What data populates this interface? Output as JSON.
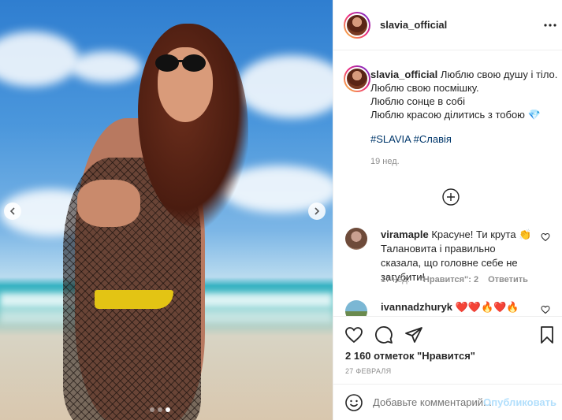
{
  "post": {
    "username": "slavia_official",
    "caption": {
      "username": "slavia_official",
      "lines": [
        "Люблю свою душу і тіло.",
        "Люблю свою посмішку.",
        "Люблю сонце в собі",
        "Люблю красою ділитись з тобою"
      ],
      "hashtags": "#SLAVIA #Славія",
      "time_ago": "19 нед."
    },
    "comments": [
      {
        "username": "viramaple",
        "text": "Красуне! Ти крута 👏 Талановита і правильно сказала, що головне себе не загубити!",
        "time": "17 нед.",
        "likes": "\"Нравится\": 2",
        "reply": "Ответить"
      },
      {
        "username": "ivannadzhuryk",
        "text": "❤️❤️🔥❤️🔥"
      }
    ],
    "likes_count": "2 160 отметок \"Нравится\"",
    "date": "27 ФЕВРАЛЯ",
    "add_comment_placeholder": "Добавьте комментарий...",
    "publish_label": "Опубликовать"
  },
  "icons": {
    "more": "more-icon",
    "heart": "heart-icon",
    "comment": "comment-icon",
    "share": "share-icon",
    "bookmark": "bookmark-icon",
    "smile": "emoji-icon",
    "add": "plus-circle-icon"
  },
  "colors": {
    "link": "#00376b",
    "muted": "#8e8e8e",
    "publish_disabled": "#b2dffc"
  },
  "carousel": {
    "total": 3,
    "active_index": 2
  }
}
